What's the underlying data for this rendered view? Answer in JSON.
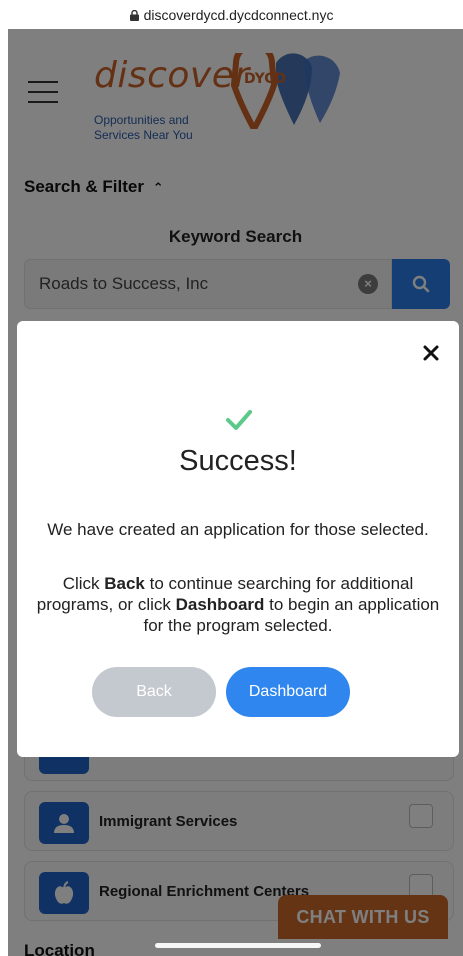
{
  "browser": {
    "url": "discoverdycd.dycdconnect.nyc"
  },
  "header": {
    "logo_word": "discover",
    "logo_badge": "DYCD",
    "tagline_line1": "Opportunities and",
    "tagline_line2": "Services Near You"
  },
  "search": {
    "section_title": "Search & Filter",
    "keyword_title": "Keyword Search",
    "keyword_value": "Roads to Success, Inc"
  },
  "categories": [
    {
      "label": "Immigrant Services"
    },
    {
      "label": "Regional Enrichment Centers"
    }
  ],
  "location_label": "Location",
  "chat_button": "CHAT WITH US",
  "modal": {
    "title": "Success!",
    "message_1": "We have created an application for those selected.",
    "message_2_prefix": "Click ",
    "message_2_back": "Back",
    "message_2_mid": " to continue searching for additional programs, or click ",
    "message_2_dashboard": "Dashboard",
    "message_2_suffix": " to begin an application for the program selected.",
    "back_label": "Back",
    "dashboard_label": "Dashboard"
  },
  "colors": {
    "brand_orange": "#c8622a",
    "brand_blue": "#2a5aa8",
    "primary_button": "#2f86ef",
    "secondary_button": "#c4c8cf",
    "success_check": "#5cc98a"
  }
}
